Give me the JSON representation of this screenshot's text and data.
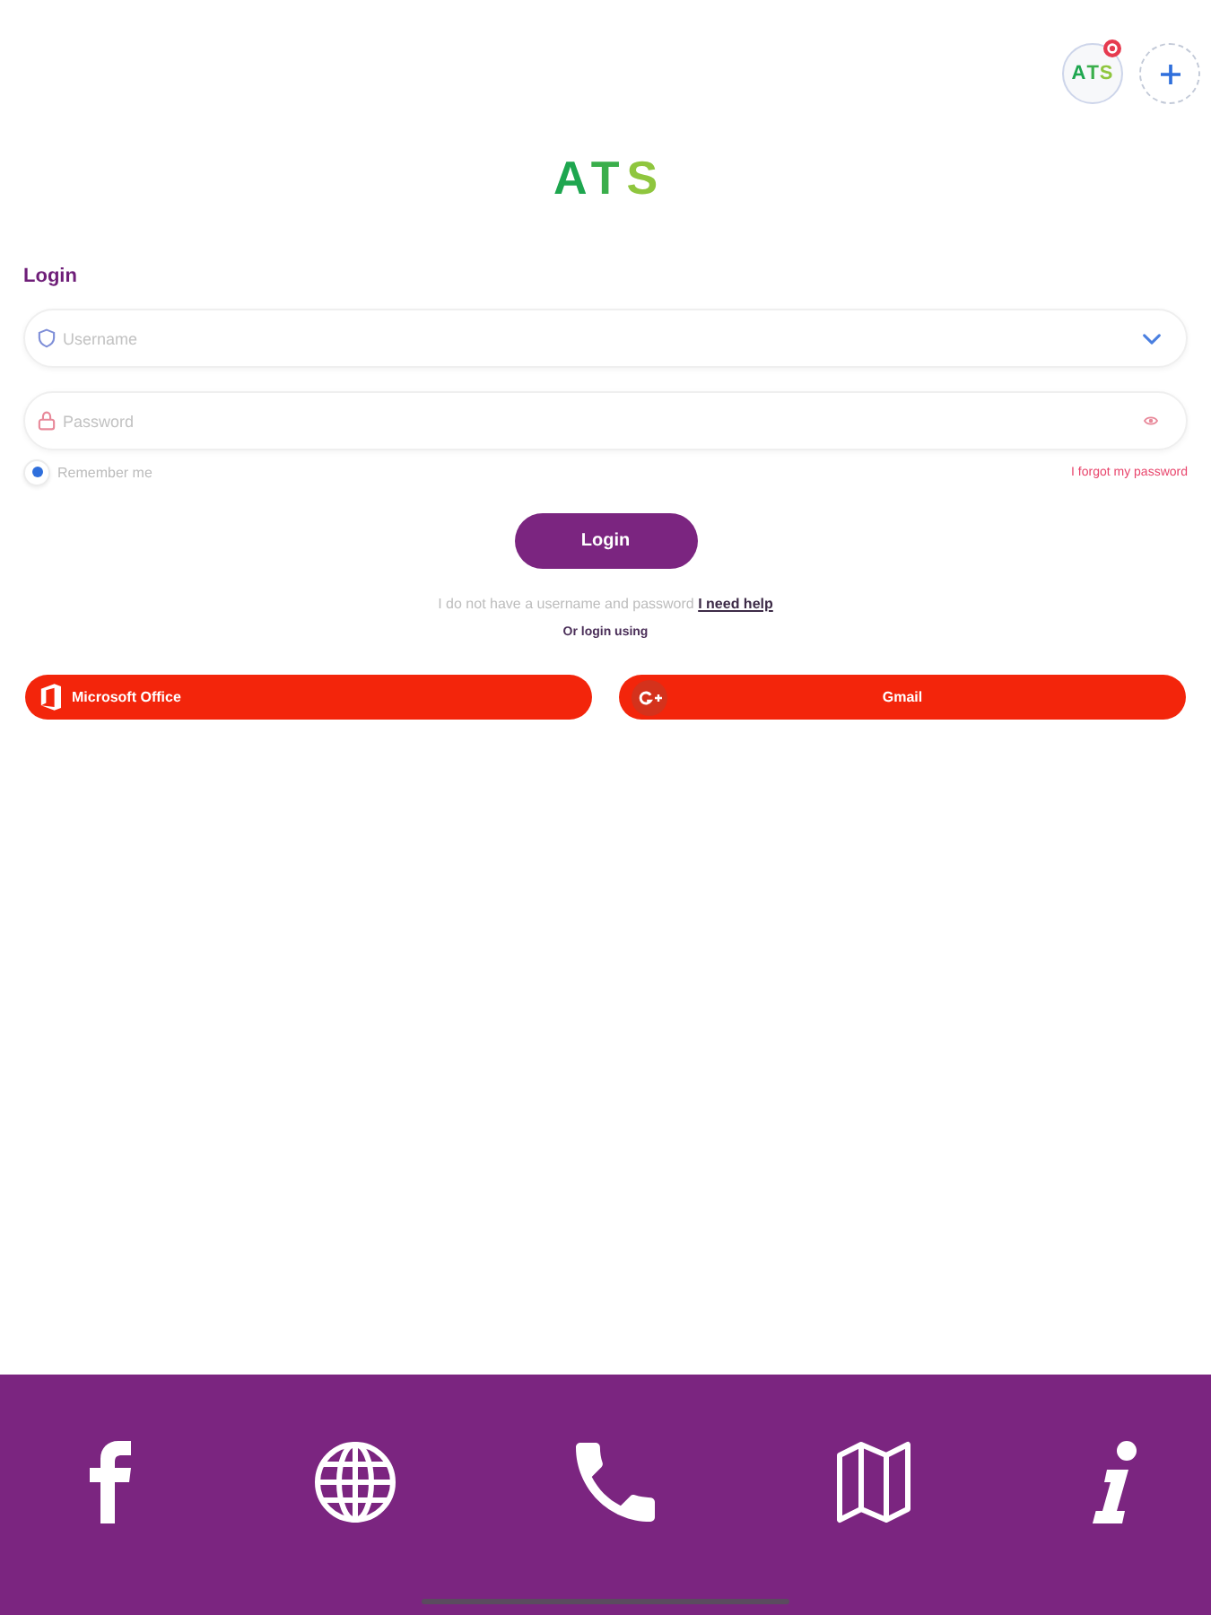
{
  "header": {
    "avatar": {
      "initials": "ATS",
      "notification": true
    }
  },
  "logo": "ATS",
  "login": {
    "title": "Login",
    "fields": [
      {
        "kind": "select",
        "placeholder": "Username"
      },
      {
        "kind": "password",
        "placeholder": "Password"
      }
    ],
    "remember": {
      "label": "Remember me",
      "checked": true
    },
    "forgot_link": "I forgot my password",
    "submit": "Login",
    "help": {
      "text": "I do not have a username and password",
      "link": "I need help"
    },
    "alt_label": "Or login using",
    "providers": [
      {
        "kind": "office",
        "label": "Microsoft Office"
      },
      {
        "kind": "google",
        "label": "Gmail"
      }
    ]
  }
}
